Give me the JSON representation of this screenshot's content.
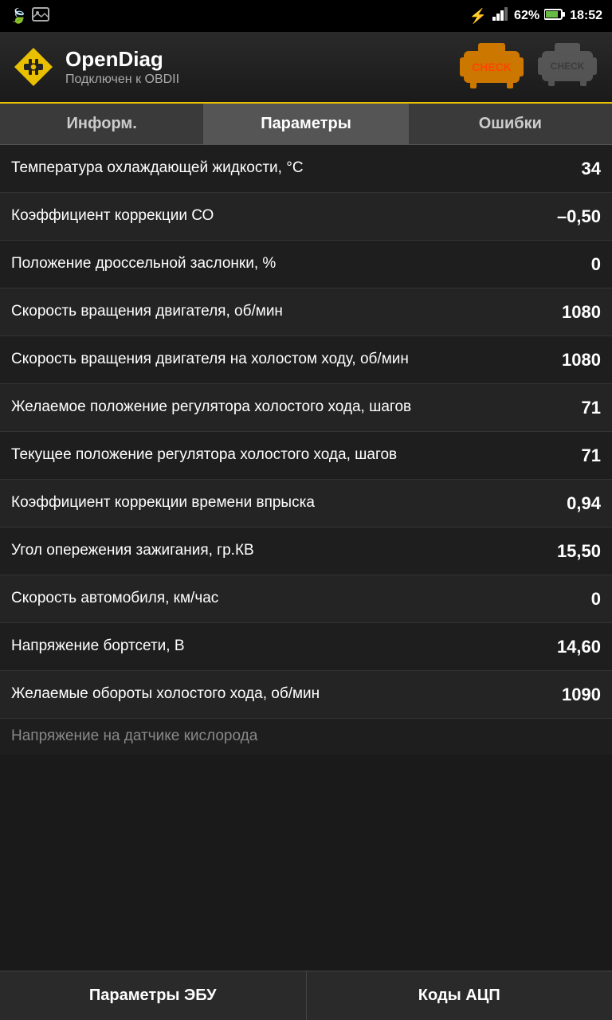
{
  "statusBar": {
    "battery": "62%",
    "time": "18:52"
  },
  "header": {
    "appName": "OpenDiag",
    "subtitle": "Подключен к OBDII",
    "checkActive": "CHECK",
    "checkInactive": "CHECK"
  },
  "tabs": [
    {
      "id": "info",
      "label": "Информ.",
      "active": false
    },
    {
      "id": "params",
      "label": "Параметры",
      "active": true
    },
    {
      "id": "errors",
      "label": "Ошибки",
      "active": false
    }
  ],
  "dataRows": [
    {
      "label": "Температура охлаждающей жидкости, °С",
      "value": "34"
    },
    {
      "label": "Коэффициент коррекции СО",
      "value": "–0,50"
    },
    {
      "label": "Положение дроссельной заслонки, %",
      "value": "0"
    },
    {
      "label": "Скорость вращения двигателя, об/мин",
      "value": "1080"
    },
    {
      "label": "Скорость вращения двигателя на холостом ходу, об/мин",
      "value": "1080"
    },
    {
      "label": "Желаемое положение регулятора холостого хода, шагов",
      "value": "71"
    },
    {
      "label": "Текущее положение регулятора холостого хода, шагов",
      "value": "71"
    },
    {
      "label": "Коэффициент коррекции времени впрыска",
      "value": "0,94"
    },
    {
      "label": "Угол опережения зажигания, гр.КВ",
      "value": "15,50"
    },
    {
      "label": "Скорость автомобиля, км/час",
      "value": "0"
    },
    {
      "label": "Напряжение бортсети, В",
      "value": "14,60"
    },
    {
      "label": "Желаемые обороты холостого хода, об/мин",
      "value": "1090"
    }
  ],
  "partialRow": {
    "label": "Напряжение на датчике кислорода"
  },
  "bottomNav": [
    {
      "id": "ecu",
      "label": "Параметры ЭБУ"
    },
    {
      "id": "adc",
      "label": "Коды АЦП"
    }
  ]
}
